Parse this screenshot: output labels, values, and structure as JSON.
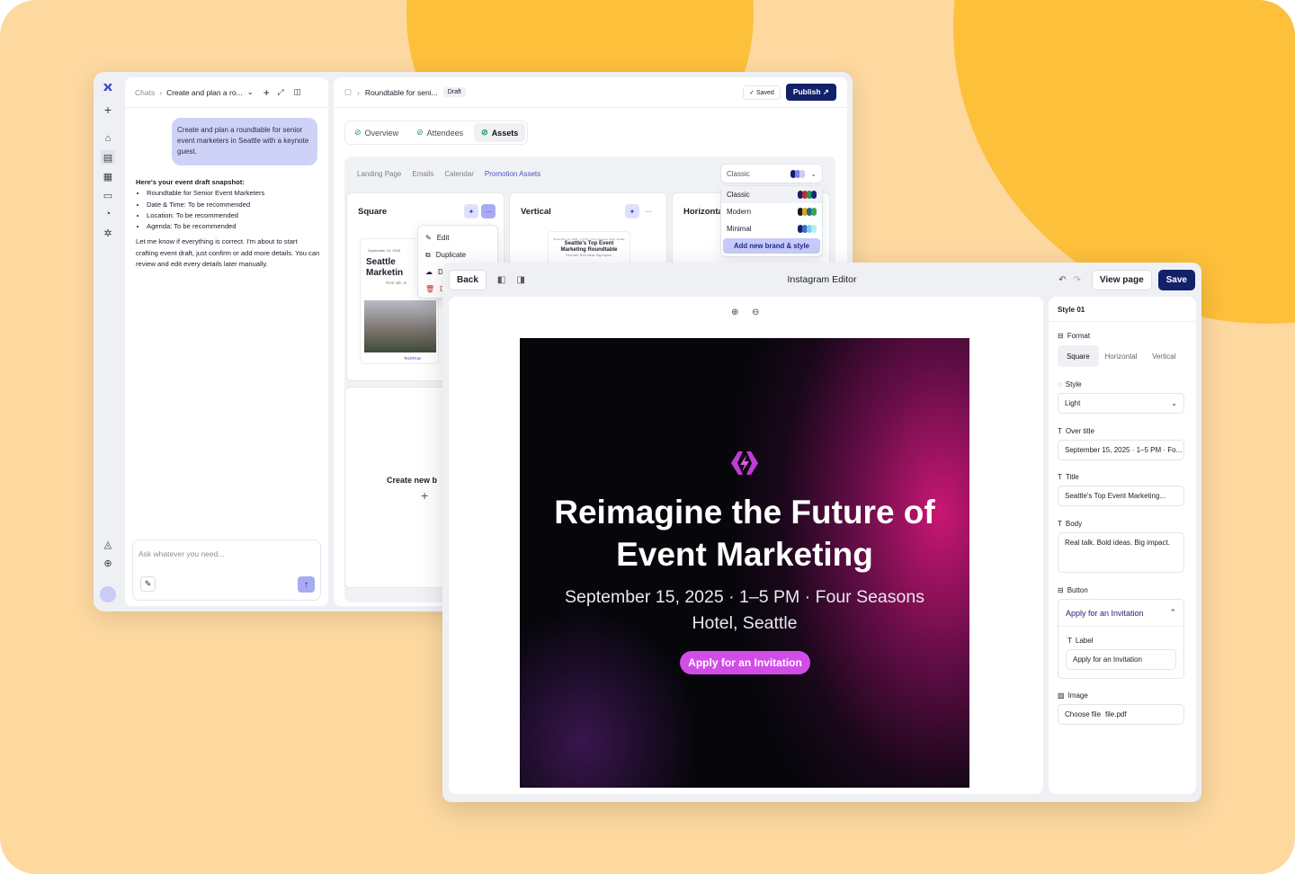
{
  "chat": {
    "breadcrumb_root": "Chats",
    "breadcrumb_current": "Create and plan a ro...",
    "user_message": "Create and plan a roundtable for senior event marketers in Seattle with a keynote guest.",
    "snapshot_title": "Here's your event draft snapshot:",
    "snapshot_items": [
      "Roundtable for Senior Event Marketers",
      "Date & Time: To be recommended",
      "Location: To be recommended",
      "Agenda: To be recommended"
    ],
    "closing": "Let me know if everything is correct. I'm about to start crafting event draft, just confirm or add more details. You can review and edit every details later manually.",
    "input_placeholder": "Ask whatever you need..."
  },
  "event": {
    "breadcrumb": "Roundtable for seni...",
    "status": "Draft",
    "saved_label": "Saved",
    "publish_label": "Publish",
    "tabs": [
      "Overview",
      "Attendees",
      "Assets"
    ],
    "subtabs": [
      "Landing Page",
      "Emails",
      "Calendar",
      "Promotion Assets"
    ],
    "style_select": "Classic",
    "style_options": [
      "Classic",
      "Modern",
      "Minimal"
    ],
    "add_brand_label": "Add new brand & style",
    "cards": [
      "Square",
      "Vertical",
      "Horizonta"
    ],
    "context_menu": [
      "Edit",
      "Duplicate",
      "Do",
      "De"
    ],
    "preview_square_date": "September 15, 2025",
    "preview_square_title": "Seattle Marketin",
    "preview_square_body": "Real talk. B",
    "preview_square_brand": "TechFlow",
    "preview_vertical_over": "September 15, 2025 · 1-5 PM · Four Seasons Hotel, Seattle",
    "preview_vertical_title": "Seattle's Top Event Marketing Roundtable",
    "preview_vertical_body": "Real talk. Bold ideas. Big impact.",
    "create_new_label": "Create new b"
  },
  "editor": {
    "back_label": "Back",
    "title": "Instagram Editor",
    "view_page_label": "View page",
    "save_label": "Save",
    "poster": {
      "title": "Reimagine the Future of Event Marketing",
      "subtitle": "September 15, 2025 · 1–5 PM · Four Seasons Hotel, Seattle",
      "button": "Apply for an Invitation"
    },
    "panel": {
      "style_name": "Style 01",
      "format_label": "Format",
      "formats": [
        "Square",
        "Horizontal",
        "Vertical"
      ],
      "style_label": "Style",
      "style_value": "Light",
      "over_title_label": "Over title",
      "over_title_value": "September 15, 2025 · 1–5 PM · Fo...",
      "title_label": "Title",
      "title_value": "Seattle's Top Event Marketing...",
      "body_label": "Body",
      "body_value": "Real talk. Bold ideas. Big impact.",
      "button_label": "Button",
      "button_value": "Apply for an Invitation",
      "label_label": "Label",
      "label_value": "Apply for an Invitation",
      "image_label": "Image",
      "file_button": "Choose file",
      "file_name": "file.pdf"
    }
  },
  "colors": {
    "background": "#fdd9a0",
    "blob": "#fdc03b",
    "primary": "#12216a",
    "accent": "#d24de8",
    "highlight": "#cfd2f7"
  }
}
